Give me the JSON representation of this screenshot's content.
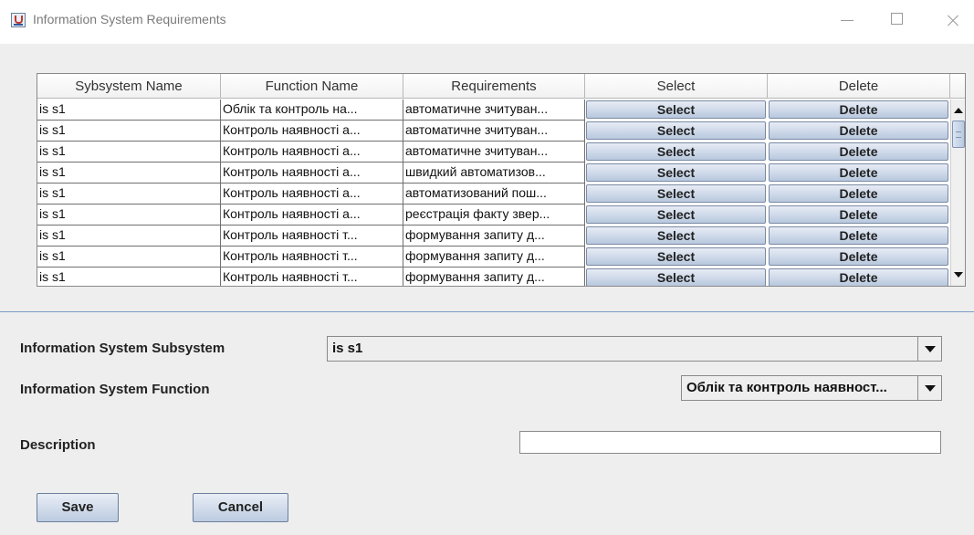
{
  "window": {
    "title": "Information System Requirements",
    "icon": "java-app-icon"
  },
  "table": {
    "columns": [
      "Sybsystem Name",
      "Function Name",
      "Requirements",
      "Select",
      "Delete"
    ],
    "rows": [
      {
        "subsystem": "is s1",
        "function": "Облік та контроль на...",
        "requirement": "автоматичне зчитуван...",
        "select": "Select",
        "delete": "Delete"
      },
      {
        "subsystem": "is s1",
        "function": "Контроль наявності а...",
        "requirement": "автоматичне зчитуван...",
        "select": "Select",
        "delete": "Delete"
      },
      {
        "subsystem": "is s1",
        "function": "Контроль наявності а...",
        "requirement": "автоматичне зчитуван...",
        "select": "Select",
        "delete": "Delete"
      },
      {
        "subsystem": "is s1",
        "function": "Контроль наявності а...",
        "requirement": "швидкий автоматизов...",
        "select": "Select",
        "delete": "Delete"
      },
      {
        "subsystem": "is s1",
        "function": "Контроль наявності а...",
        "requirement": "автоматизований пош...",
        "select": "Select",
        "delete": "Delete"
      },
      {
        "subsystem": "is s1",
        "function": "Контроль наявності а...",
        "requirement": "реєстрація факту звер...",
        "select": "Select",
        "delete": "Delete"
      },
      {
        "subsystem": "is s1",
        "function": "Контроль наявності т...",
        "requirement": "формування запиту д...",
        "select": "Select",
        "delete": "Delete"
      },
      {
        "subsystem": "is s1",
        "function": "Контроль наявності т...",
        "requirement": "формування запиту д...",
        "select": "Select",
        "delete": "Delete"
      },
      {
        "subsystem": "is s1",
        "function": "Контроль наявності т...",
        "requirement": "формування запиту д...",
        "select": "Select",
        "delete": "Delete"
      }
    ]
  },
  "form": {
    "subsystem_label": "Information System Subsystem",
    "subsystem_value": "is s1",
    "function_label": "Information System Function",
    "function_value": "Облік та контроль наявност...",
    "description_label": "Description",
    "description_value": ""
  },
  "buttons": {
    "save": "Save",
    "cancel": "Cancel"
  }
}
